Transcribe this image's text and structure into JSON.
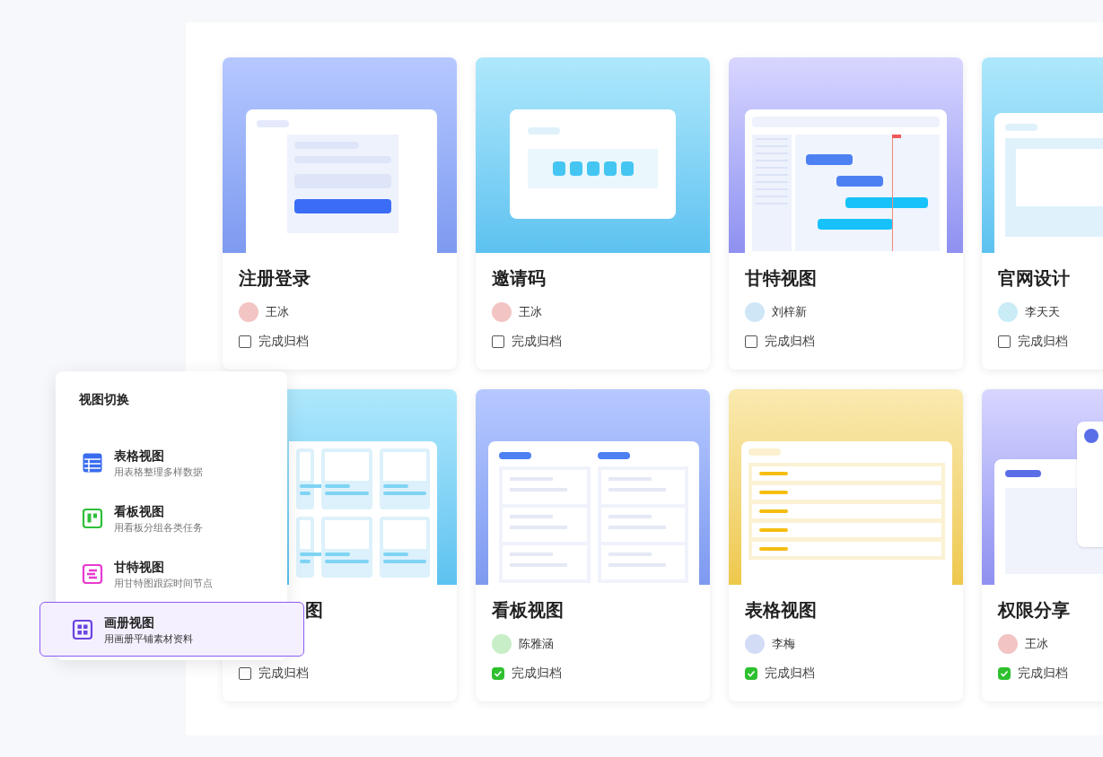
{
  "cards": [
    {
      "title": "注册登录",
      "kind": "form",
      "owner": {
        "name": "王冰"
      },
      "archive": {
        "label": "完成归档",
        "checked": false
      }
    },
    {
      "title": "邀请码",
      "kind": "code",
      "owner": {
        "name": "王冰"
      },
      "archive": {
        "label": "完成归档",
        "checked": false
      }
    },
    {
      "title": "甘特视图",
      "kind": "gantt",
      "owner": {
        "name": "刘梓新"
      },
      "archive": {
        "label": "完成归档",
        "checked": false
      }
    },
    {
      "title": "官网设计",
      "kind": "web",
      "owner": {
        "name": "李天天"
      },
      "archive": {
        "label": "完成归档",
        "checked": false
      }
    },
    {
      "title": "图",
      "kind": "grid",
      "archive": {
        "label": "完成归档",
        "checked": false
      }
    },
    {
      "title": "看板视图",
      "kind": "kanban",
      "owner": {
        "name": "陈雅涵"
      },
      "archive": {
        "label": "完成归档",
        "checked": true
      }
    },
    {
      "title": "表格视图",
      "kind": "table",
      "owner": {
        "name": "李梅"
      },
      "archive": {
        "label": "完成归档",
        "checked": true
      }
    },
    {
      "title": "权限分享",
      "kind": "share",
      "owner": {
        "name": "王冰"
      },
      "archive": {
        "label": "完成归档",
        "checked": true
      }
    }
  ],
  "view_menu": {
    "title": "视图切换",
    "items": [
      {
        "kind": "table",
        "label": "表格视图",
        "hint": "用表格整理多样数据",
        "selected": false
      },
      {
        "kind": "kanban",
        "label": "看板视图",
        "hint": "用看板分组各类任务",
        "selected": false
      },
      {
        "kind": "gantt",
        "label": "甘特视图",
        "hint": "用甘特图跟踪时间节点",
        "selected": false
      },
      {
        "kind": "gallery",
        "label": "画册视图",
        "hint": "用画册平铺素材资料",
        "selected": true
      }
    ]
  }
}
